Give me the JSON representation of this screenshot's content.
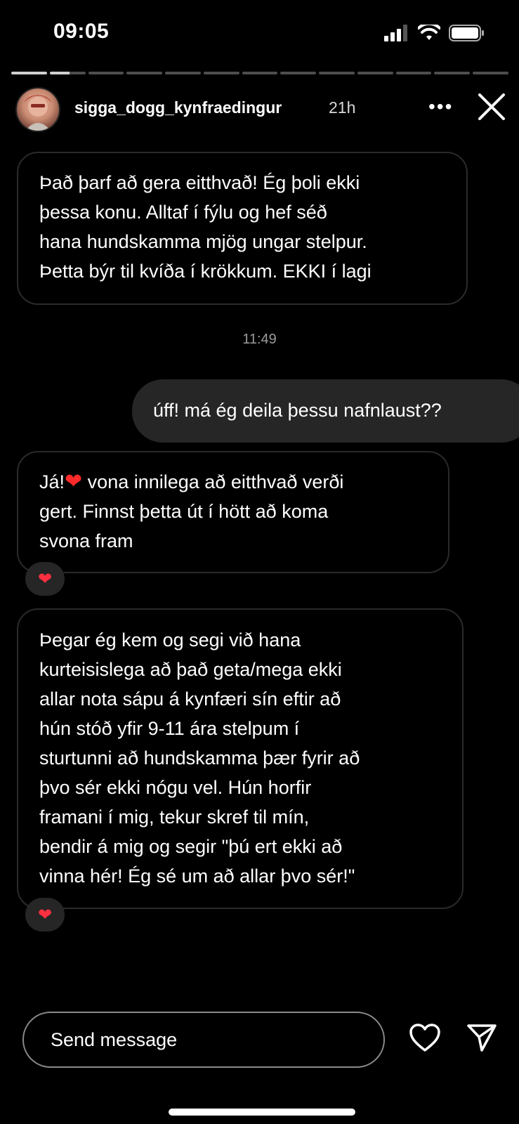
{
  "status_bar": {
    "time": "09:05"
  },
  "story": {
    "segments_total": 13,
    "segments_completed": 1,
    "current_segment_progress": 0.55
  },
  "header": {
    "username": "sigga_dogg_kynfraedingur",
    "age": "21h",
    "more_label": "•••"
  },
  "messages": {
    "m1_lines": [
      "Það þarf að gera eitthvað! Ég þoli ekki",
      "þessa konu. Alltaf í fýlu og hef séð",
      "hana hundskamma mjög ungar stelpur.",
      "Þetta býr til kvíða í krökkum. EKKI í lagi"
    ],
    "timestamp": "11:49",
    "m2_text": "úff! má ég deila þessu nafnlaust??",
    "m3_prefix": "Já!",
    "m3_heart": "❤",
    "m3_lines": [
      " vona innilega að eitthvað verði",
      "gert. Finnst þetta út í hött að koma",
      "svona fram"
    ],
    "m4_lines": [
      "Þegar ég kem og segi við hana",
      "kurteisislega að það geta/mega ekki",
      "allar nota sápu á kynfæri sín eftir að",
      "hún stóð yfir 9-11 ára stelpum í",
      "sturtunni að hundskamma þær fyrir að",
      "þvo sér ekki nógu vel. Hún horfir",
      "framani í mig, tekur skref til mín,",
      "bendir á mig og segir \"þú ert ekki að",
      "vinna hér! Ég sé um að allar þvo sér!\""
    ],
    "reaction": "❤"
  },
  "footer": {
    "send_placeholder": "Send message"
  },
  "icons": {
    "signal": "cellular-signal-icon",
    "wifi": "wifi-icon",
    "battery": "battery-icon",
    "close": "close-icon",
    "like": "heart-icon",
    "share": "send-icon"
  }
}
